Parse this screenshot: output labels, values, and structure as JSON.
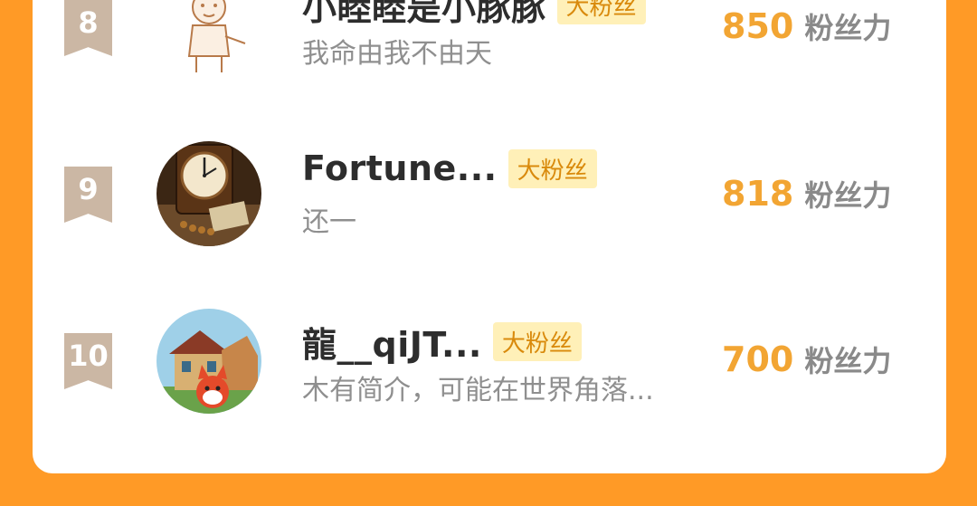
{
  "fans": [
    {
      "rank": "8",
      "name": "小睦睦是小豚豚",
      "badge": "大粉丝",
      "desc": "我命由我不由天",
      "score": "850",
      "unit": "粉丝力",
      "avatar": "cartoon-cowboy-avatar"
    },
    {
      "rank": "9",
      "name": "Fortune...",
      "badge": "大粉丝",
      "desc": "还一",
      "score": "818",
      "unit": "粉丝力",
      "avatar": "antique-clock-avatar"
    },
    {
      "rank": "10",
      "name": "龍__qiJT...",
      "badge": "大粉丝",
      "desc": "木有简介，可能在世界角落...",
      "score": "700",
      "unit": "粉丝力",
      "avatar": "cartoon-fox-house-avatar"
    }
  ],
  "colors": {
    "background": "#FF9A26",
    "card": "#FFFFFF",
    "rank_ribbon": "#CBB7A4",
    "score": "#F2A533",
    "badge_bg": "#FFF0B8"
  }
}
